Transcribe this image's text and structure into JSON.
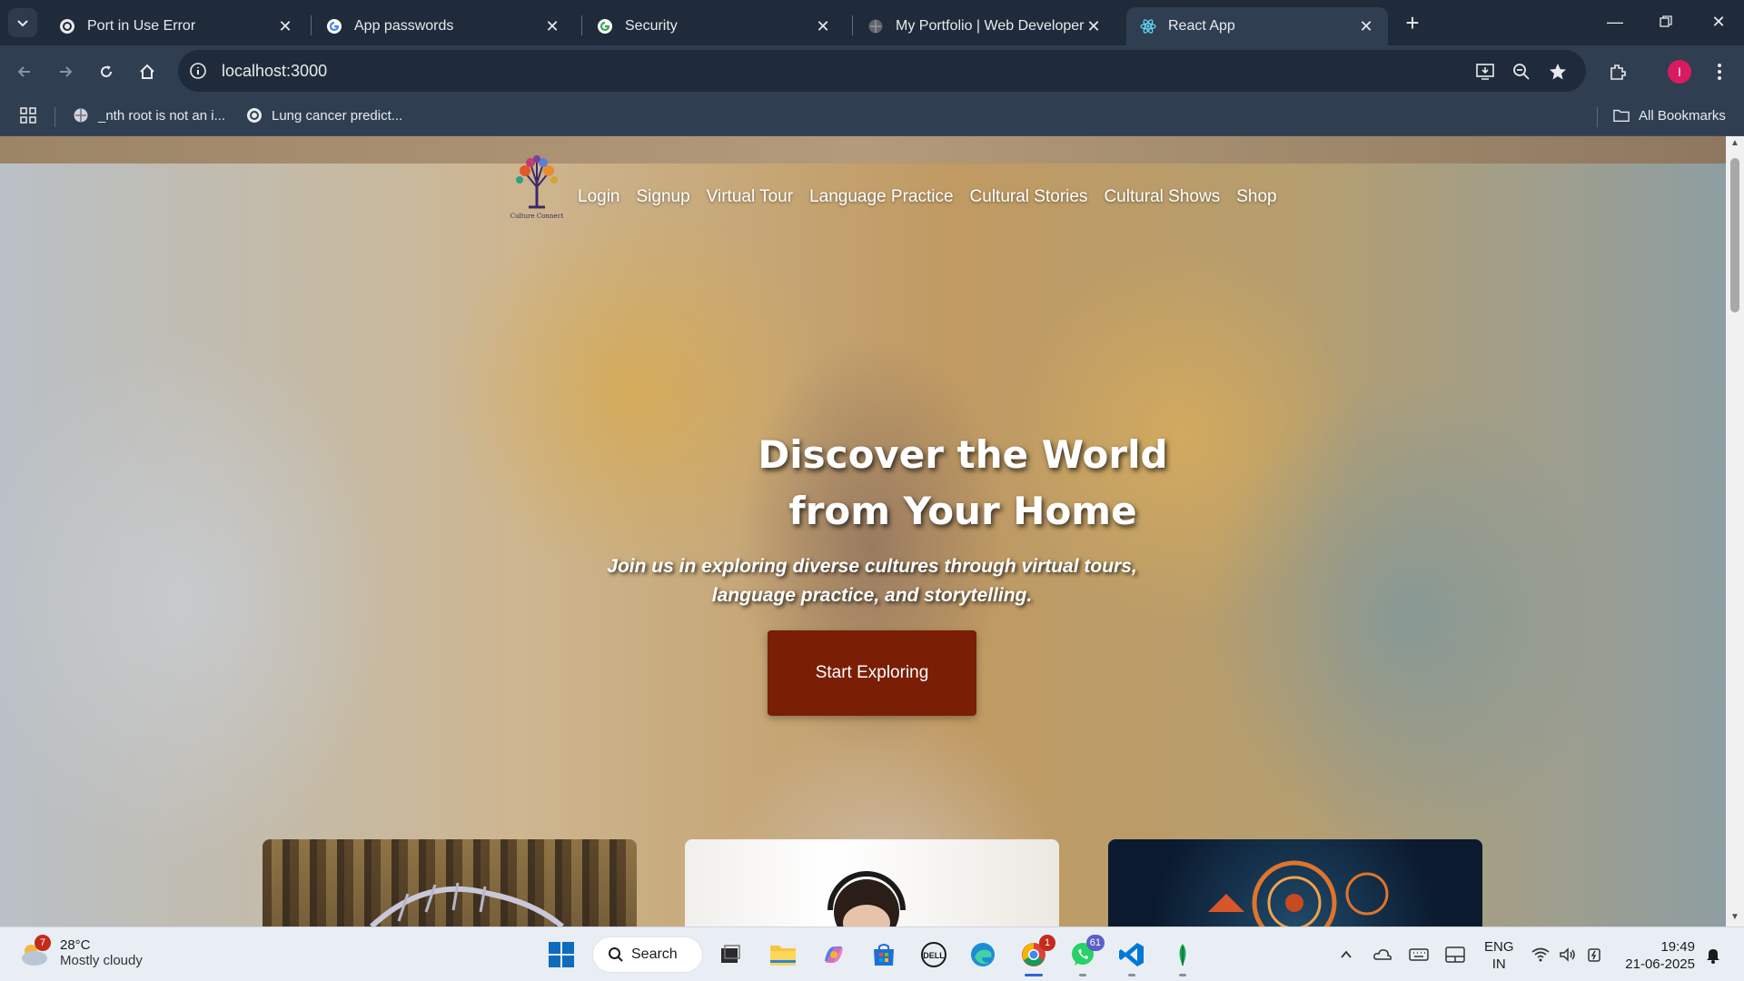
{
  "tabs": [
    {
      "title": "Port in Use Error",
      "icon": "openai-icon"
    },
    {
      "title": "App passwords",
      "icon": "google-icon"
    },
    {
      "title": "Security",
      "icon": "google-icon"
    },
    {
      "title": "My Portfolio | Web Developer",
      "icon": "globe-icon"
    },
    {
      "title": "React App",
      "icon": "react-icon",
      "active": true
    }
  ],
  "omnibox": {
    "url": "localhost:3000"
  },
  "bookmarks": {
    "items": [
      {
        "label": "_nth root is not an i...",
        "icon": "globe-icon"
      },
      {
        "label": "Lung cancer predict...",
        "icon": "openai-icon"
      }
    ],
    "all_label": "All Bookmarks"
  },
  "site": {
    "logo_caption": "Culture Connect",
    "nav": [
      "Login",
      "Signup",
      "Virtual Tour",
      "Language Practice",
      "Cultural Stories",
      "Cultural Shows",
      "Shop"
    ],
    "hero": {
      "title_line1": "Discover the World",
      "title_line2": "from Your Home",
      "subtitle_line1": "Join us in exploring diverse cultures through virtual tours,",
      "subtitle_line2": "language practice, and storytelling.",
      "cta": "Start Exploring"
    }
  },
  "taskbar": {
    "weather": {
      "temp": "28°C",
      "desc": "Mostly cloudy",
      "badge": "7"
    },
    "search_label": "Search",
    "chrome_badge": "1",
    "whatsapp_badge": "61",
    "lang_line1": "ENG",
    "lang_line2": "IN",
    "time": "19:49",
    "date": "21-06-2025"
  },
  "colors": {
    "cta": "#7a1e05",
    "tab_active": "#2f3e51",
    "tabstrip": "#1f2b3a"
  }
}
